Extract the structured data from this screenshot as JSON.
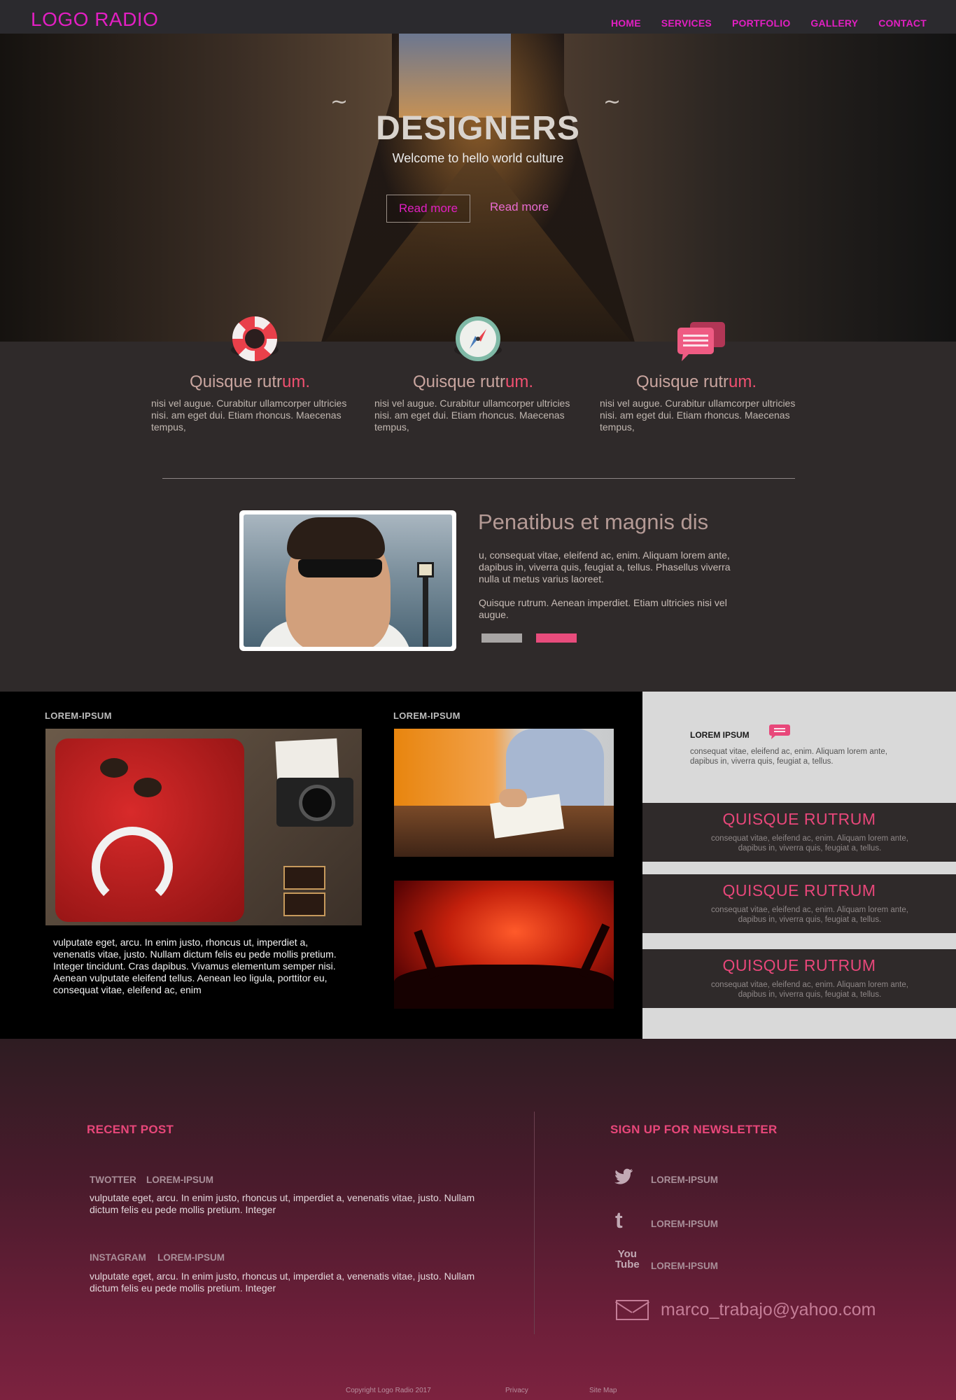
{
  "nav": {
    "logo": "LOGO RADIO",
    "items": [
      "HOME",
      "SERVICES",
      "PORTFOLIO",
      "GALLERY",
      "CONTACT"
    ]
  },
  "hero": {
    "title": "DESIGNERS",
    "subtitle": "Welcome to hello world culture",
    "primary_button": "Read more",
    "secondary_button": "Read more"
  },
  "features": [
    {
      "icon": "lifebuoy-icon",
      "title_main": "Quisque rutr",
      "title_accent": "um.",
      "text": "nisi vel augue. Curabitur ullamcorper ultricies nisi. am eget dui. Etiam rhoncus. Maecenas tempus,"
    },
    {
      "icon": "compass-icon",
      "title_main": "Quisque rutr",
      "title_accent": "um.",
      "text": "nisi vel augue. Curabitur ullamcorper ultricies nisi. am eget dui. Etiam rhoncus. Maecenas tempus,"
    },
    {
      "icon": "chat-bubbles-icon",
      "title_main": "Quisque rutr",
      "title_accent": "um.",
      "text": "nisi vel augue. Curabitur ullamcorper ultricies nisi. am eget dui. Etiam rhoncus. Maecenas tempus,"
    }
  ],
  "bio": {
    "title": "Penatibus et magnis dis",
    "p1": "u, consequat vitae, eleifend ac, enim. Aliquam lorem ante, dapibus in, viverra quis, feugiat a, tellus. Phasellus viverra nulla ut metus varius laoreet.",
    "p2": "Quisque rutrum. Aenean imperdiet. Etiam ultricies nisi vel augue."
  },
  "gallery": {
    "label_left": "LOREM-IPSUM",
    "label_mid": "LOREM-IPSUM",
    "text": "vulputate eget, arcu. In enim justo, rhoncus ut, imperdiet a, venenatis vitae, justo. Nullam dictum felis eu pede mollis pretium. Integer tincidunt. Cras dapibus. Vivamus elementum semper nisi. Aenean vulputate eleifend tellus. Aenean leo ligula, porttitor eu, consequat vitae, eleifend ac, enim"
  },
  "sidebar": {
    "top_title": "LOREM IPSUM",
    "top_text": "consequat vitae, eleifend ac, enim. Aliquam lorem ante, dapibus in, viverra quis, feugiat a, tellus.",
    "cards": [
      {
        "title": "QUISQUE RUTRUM",
        "text": "consequat vitae, eleifend ac, enim. Aliquam lorem ante, dapibus in, viverra quis, feugiat a, tellus."
      },
      {
        "title": "QUISQUE RUTRUM",
        "text": "consequat vitae, eleifend ac, enim. Aliquam lorem ante, dapibus in, viverra quis, feugiat a, tellus."
      },
      {
        "title": "QUISQUE RUTRUM",
        "text": "consequat vitae, eleifend ac, enim. Aliquam lorem ante, dapibus in, viverra quis, feugiat a, tellus."
      }
    ]
  },
  "footer": {
    "recent_heading": "RECENT POST",
    "posts": [
      {
        "source": "TWOTTER",
        "label": "LOREM-IPSUM",
        "text": "vulputate eget, arcu. In enim justo, rhoncus ut, imperdiet a, venenatis vitae, justo. Nullam dictum felis eu pede mollis pretium. Integer"
      },
      {
        "source": "INSTAGRAM",
        "label": "LOREM-IPSUM",
        "text": "vulputate eget, arcu. In enim justo, rhoncus ut, imperdiet a, venenatis vitae, justo. Nullam dictum felis eu pede mollis pretium. Integer"
      }
    ],
    "newsletter_heading": "SIGN UP FOR NEWSLETTER",
    "social": [
      {
        "icon": "twitter-icon",
        "label": "LOREM-IPSUM"
      },
      {
        "icon": "tumblr-icon",
        "label": "LOREM-IPSUM"
      },
      {
        "icon": "youtube-icon",
        "icon_text_top": "You",
        "icon_text_bottom": "Tube",
        "label": "LOREM-IPSUM"
      }
    ],
    "email": "marco_trabajo@yahoo.com",
    "copyright": "Copyright  Logo Radio 2017",
    "privacy": "Privacy",
    "sitemap": "Site Map"
  },
  "colors": {
    "accent_magenta": "#e21fc2",
    "accent_pink": "#e8477a",
    "dark_bg": "#2f2a2a"
  }
}
